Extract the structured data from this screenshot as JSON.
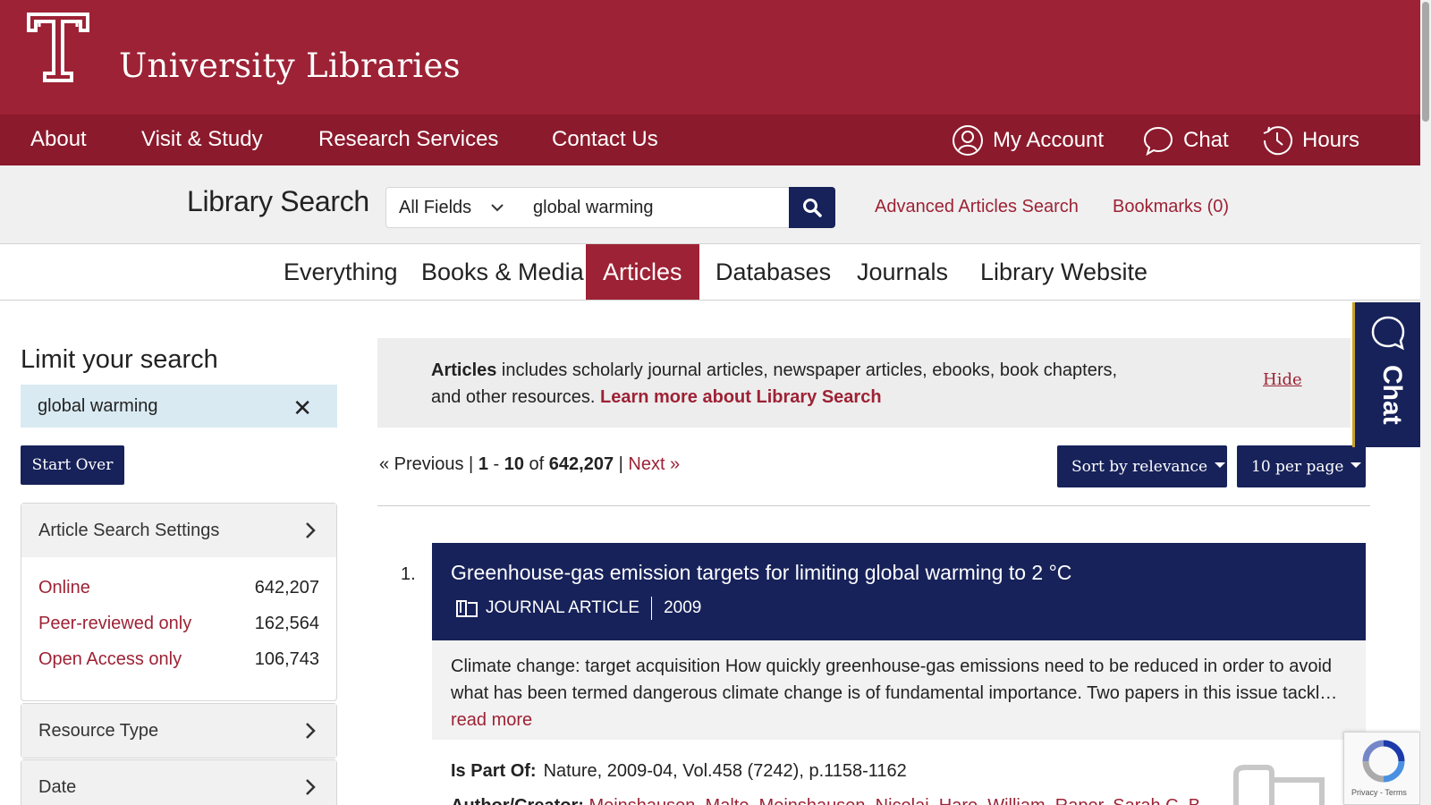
{
  "header": {
    "brand": "University Libraries",
    "nav": [
      "About",
      "Visit & Study",
      "Research Services",
      "Contact Us"
    ],
    "utility": {
      "account": "My Account",
      "chat": "Chat",
      "hours": "Hours"
    }
  },
  "search": {
    "label": "Library Search",
    "field": "All Fields",
    "query": "global warming",
    "advanced_link": "Advanced Articles Search",
    "bookmarks_link": "Bookmarks (0)"
  },
  "tabs": [
    "Everything",
    "Books & Media",
    "Articles",
    "Databases",
    "Journals",
    "Library Website"
  ],
  "active_tab": "Articles",
  "sidebar": {
    "title": "Limit your search",
    "constraint": "global warming",
    "constraint_remove": "✕",
    "start_over": "Start Over",
    "settings_panel": {
      "title": "Article Search Settings",
      "items": [
        {
          "label": "Online",
          "count": "642,207"
        },
        {
          "label": "Peer-reviewed only",
          "count": "162,564"
        },
        {
          "label": "Open Access only",
          "count": "106,743"
        }
      ]
    },
    "facets": [
      "Resource Type",
      "Date"
    ]
  },
  "info": {
    "bold": "Articles",
    "text": " includes scholarly journal articles, newspaper articles, ebooks, book chapters, and other resources. ",
    "link": "Learn more about Library Search",
    "hide": "Hide"
  },
  "pager": {
    "previous": "« Previous",
    "sep1": " | ",
    "range_start": "1",
    "dash": " - ",
    "range_end": "10",
    "of": " of ",
    "total": "642,207",
    "sep2": " | ",
    "next": "Next »"
  },
  "controls": {
    "sort": "Sort by relevance",
    "per_page": "10 per page"
  },
  "results": [
    {
      "number": "1.",
      "title": "Greenhouse-gas emission targets for limiting global warming to 2 °C",
      "type": "JOURNAL ARTICLE",
      "year": "2009",
      "snippet": "Climate change: target acquisition How quickly greenhouse-gas emissions need to be reduced in order to avoid what has been termed dangerous climate change is of fundamental importance. Two papers in this issue tackl…",
      "read_more": "read more",
      "part_of_label": "Is Part Of:",
      "part_of": "Nature, 2009-04, Vol.458 (7242), p.1158-1162",
      "authors_label": "Author/Creator:",
      "authors": "Meinshausen, Malte, Meinshausen, Nicolai, Hare, William, Raper, Sarah C. B."
    }
  ],
  "chat_widget": "Chat",
  "recaptcha": "Privacy - Terms",
  "colors": {
    "cherry": "#9d2235",
    "cherry_dark": "#8b1a2c",
    "navy": "#17225a"
  }
}
